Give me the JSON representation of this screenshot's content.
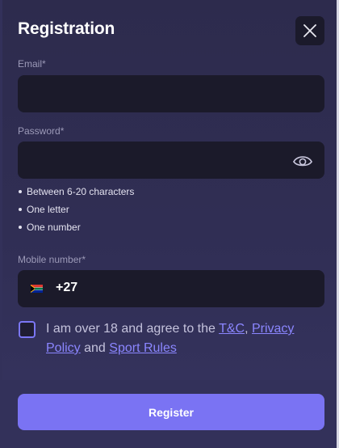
{
  "modal": {
    "title": "Registration",
    "close_icon": "close-icon"
  },
  "email": {
    "label": "Email*",
    "value": "",
    "placeholder": ""
  },
  "password": {
    "label": "Password*",
    "value": "",
    "placeholder": "",
    "toggle_icon": "eye-icon",
    "hints": [
      "Between 6-20 characters",
      "One letter",
      "One number"
    ]
  },
  "mobile": {
    "label": "Mobile number*",
    "flag_icon": "south-africa-flag-icon",
    "dial_code": "+27",
    "value": ""
  },
  "agreement": {
    "prefix": "I am over 18 and agree to the ",
    "tc_link": "T&C",
    "comma": ", ",
    "privacy_link": "Privacy Policy",
    "and": " and ",
    "rules_link": "Sport Rules",
    "checked": false
  },
  "register_button": "Register",
  "colors": {
    "accent": "#7a73f3",
    "link": "#8b86ff",
    "field_bg": "#1b1a2a",
    "modal_bg": "#2d2b4d"
  }
}
